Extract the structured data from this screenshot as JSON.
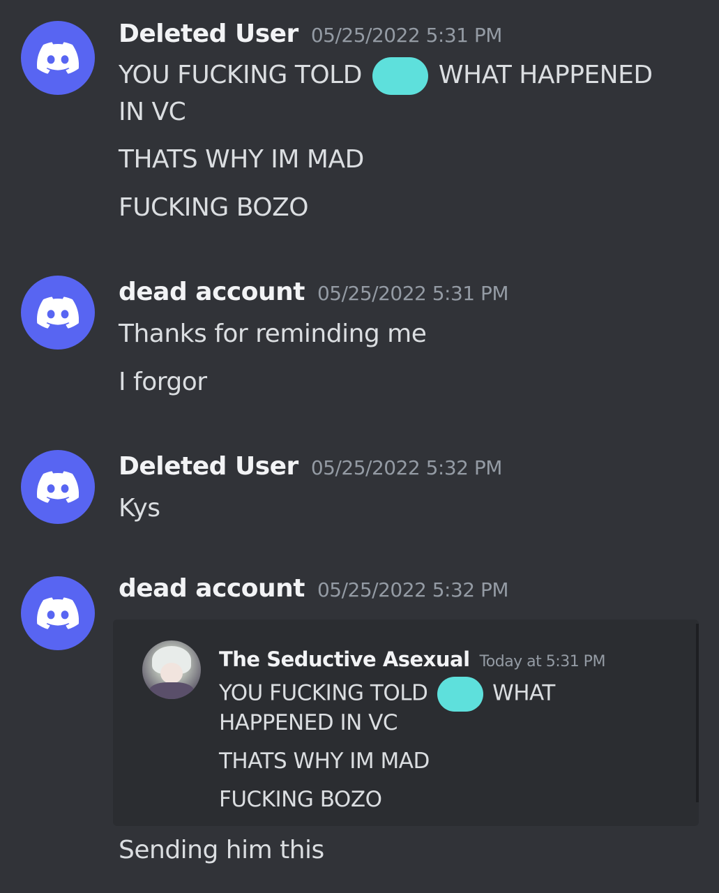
{
  "messages": [
    {
      "author": "Deleted User",
      "timestamp": "05/25/2022 5:31 PM",
      "lines": [
        "YOU FUCKING TOLD",
        "WHAT HAPPENED",
        "IN VC",
        "THATS WHY IM MAD",
        "FUCKING BOZO"
      ]
    },
    {
      "author": "dead account",
      "timestamp": "05/25/2022 5:31 PM",
      "lines": [
        "Thanks for reminding me",
        "I forgor"
      ]
    },
    {
      "author": "Deleted User",
      "timestamp": "05/25/2022 5:32 PM",
      "lines": [
        "Kys"
      ]
    },
    {
      "author": "dead account",
      "timestamp": "05/25/2022 5:32 PM",
      "embed": {
        "author": "The Seductive Asexual",
        "timestamp": "Today at 5:31 PM",
        "lines": [
          "YOU FUCKING TOLD",
          "WHAT",
          "HAPPENED IN VC",
          "THATS WHY IM MAD",
          "FUCKING BOZO"
        ]
      },
      "lines": [
        "Sending him this"
      ]
    }
  ],
  "colors": {
    "background": "#313338",
    "avatar": "#5865f2",
    "redaction": "#5ee0dc"
  },
  "icons": {
    "avatar": "discord-logo-icon"
  }
}
